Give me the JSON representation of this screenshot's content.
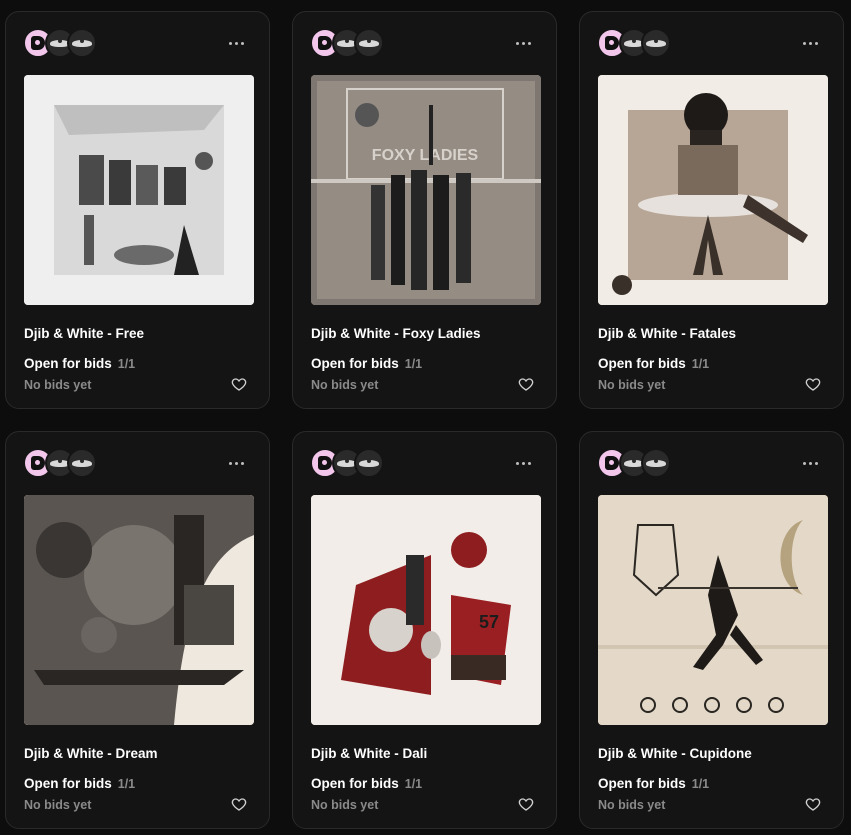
{
  "cards": [
    {
      "title": "Djib & White - Free",
      "status": "Open for bids",
      "edition": "1/1",
      "bids": "No bids yet"
    },
    {
      "title": "Djib & White - Foxy Ladies",
      "status": "Open for bids",
      "edition": "1/1",
      "bids": "No bids yet",
      "art_text": "FOXY LADIES"
    },
    {
      "title": "Djib & White - Fatales",
      "status": "Open for bids",
      "edition": "1/1",
      "bids": "No bids yet"
    },
    {
      "title": "Djib & White - Dream",
      "status": "Open for bids",
      "edition": "1/1",
      "bids": "No bids yet"
    },
    {
      "title": "Djib & White - Dali",
      "status": "Open for bids",
      "edition": "1/1",
      "bids": "No bids yet",
      "art_text": "57"
    },
    {
      "title": "Djib & White - Cupidone",
      "status": "Open for bids",
      "edition": "1/1",
      "bids": "No bids yet"
    }
  ],
  "colors": {
    "background": "#0d0d0d",
    "card": "#141414",
    "border": "#2a2a2a",
    "avatar_pink": "#f3c6ec",
    "muted_text": "#8a8a8a"
  },
  "icons": [
    "collector-avatar",
    "mustache-avatar-icon",
    "more-options-icon",
    "heart-icon"
  ]
}
